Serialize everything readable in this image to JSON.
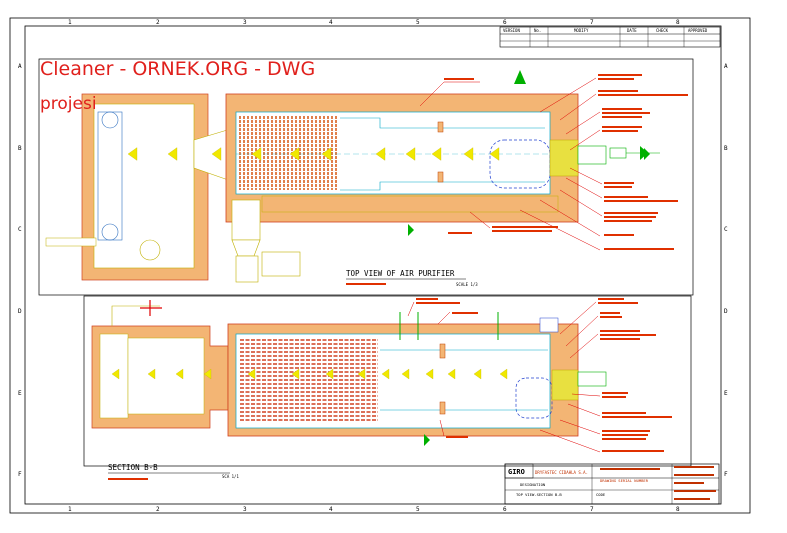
{
  "overlay": {
    "line1": "Cleaner - ORNEK.ORG - DWG",
    "line2": "projesi"
  },
  "grid": {
    "columns": [
      "1",
      "2",
      "3",
      "4",
      "5",
      "6",
      "7",
      "8"
    ],
    "rows": [
      "A",
      "B",
      "C",
      "D",
      "E",
      "F"
    ]
  },
  "revision_table": {
    "headers": [
      "VERSION",
      "No.",
      "MODIFY",
      "DATE",
      "CHECK",
      "APPROVED"
    ]
  },
  "top_view": {
    "title": "TOP VIEW OF AIR PURIFIER",
    "scale_label": "SCALE 1/3"
  },
  "section_view": {
    "title": "SECTION  B-B",
    "scale_label": "SCA 1/1"
  },
  "title_block": {
    "logo": "GIRO",
    "company": "DRYFASTEC CIDAHLA S.A.",
    "drawing_name_label": "DRAWING  SERIAL NUMBER",
    "designation": "DESIGNATION",
    "drawing_title": "TOP VIEW-SECTION B-B",
    "code_label": "CODE"
  }
}
